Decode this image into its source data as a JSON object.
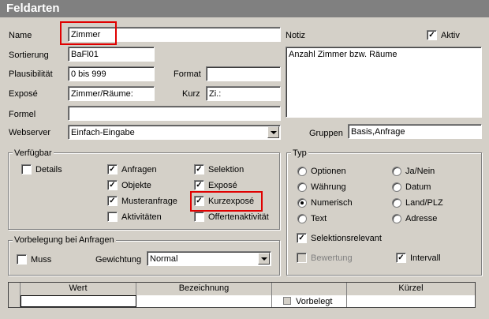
{
  "window": {
    "title": "Feldarten"
  },
  "labels": {
    "name": "Name",
    "sortierung": "Sortierung",
    "plausibilitaet": "Plausibilität",
    "format": "Format",
    "expose": "Exposé",
    "kurz": "Kurz",
    "formel": "Formel",
    "webserver": "Webserver",
    "notiz": "Notiz",
    "gruppen": "Gruppen"
  },
  "fields": {
    "name": "Zimmer",
    "sortierung": "BaFl01",
    "plausibilitaet": "0 bis 999",
    "format": "",
    "expose": "Zimmer/Räume:",
    "kurz": "Zi.:",
    "formel": "",
    "webserver": "Einfach-Eingabe",
    "notiz": "Anzahl Zimmer bzw. Räume",
    "gruppen": "Basis,Anfrage"
  },
  "aktiv": {
    "label": "Aktiv",
    "checked": true
  },
  "verfuegbar": {
    "legend": "Verfügbar",
    "items": [
      {
        "label": "Details",
        "checked": false
      },
      {
        "label": "Anfragen",
        "checked": true
      },
      {
        "label": "Selektion",
        "checked": true
      },
      {
        "label": "Objekte",
        "checked": true
      },
      {
        "label": "Exposé",
        "checked": true
      },
      {
        "label": "Musteranfrage",
        "checked": true
      },
      {
        "label": "Kurzexposé",
        "checked": true
      },
      {
        "label": "Aktivitäten",
        "checked": false
      },
      {
        "label": "Offertenaktivität",
        "checked": false
      }
    ]
  },
  "typ": {
    "legend": "Typ",
    "options": [
      "Optionen",
      "Ja/Nein",
      "Währung",
      "Datum",
      "Numerisch",
      "Land/PLZ",
      "Text",
      "Adresse"
    ],
    "selected": "Numerisch",
    "selektionsrelevant": {
      "label": "Selektionsrelevant",
      "checked": true
    },
    "bewertung": {
      "label": "Bewertung",
      "checked": false,
      "disabled": true
    },
    "intervall": {
      "label": "Intervall",
      "checked": true
    }
  },
  "vorbelegung": {
    "legend": "Vorbelegung bei Anfragen",
    "muss": {
      "label": "Muss",
      "checked": false
    },
    "gewichtung_label": "Gewichtung",
    "gewichtung_value": "Normal"
  },
  "grid": {
    "columns": [
      "Wert",
      "Bezeichnung",
      "",
      "Kürzel"
    ],
    "row": {
      "wert": "",
      "bezeichnung": "",
      "vorbelegt_label": "Vorbelegt",
      "kuerzel": ""
    }
  },
  "colors": {
    "titlebar": "#808080",
    "highlight": "#e00000",
    "face": "#d4d0c8"
  }
}
